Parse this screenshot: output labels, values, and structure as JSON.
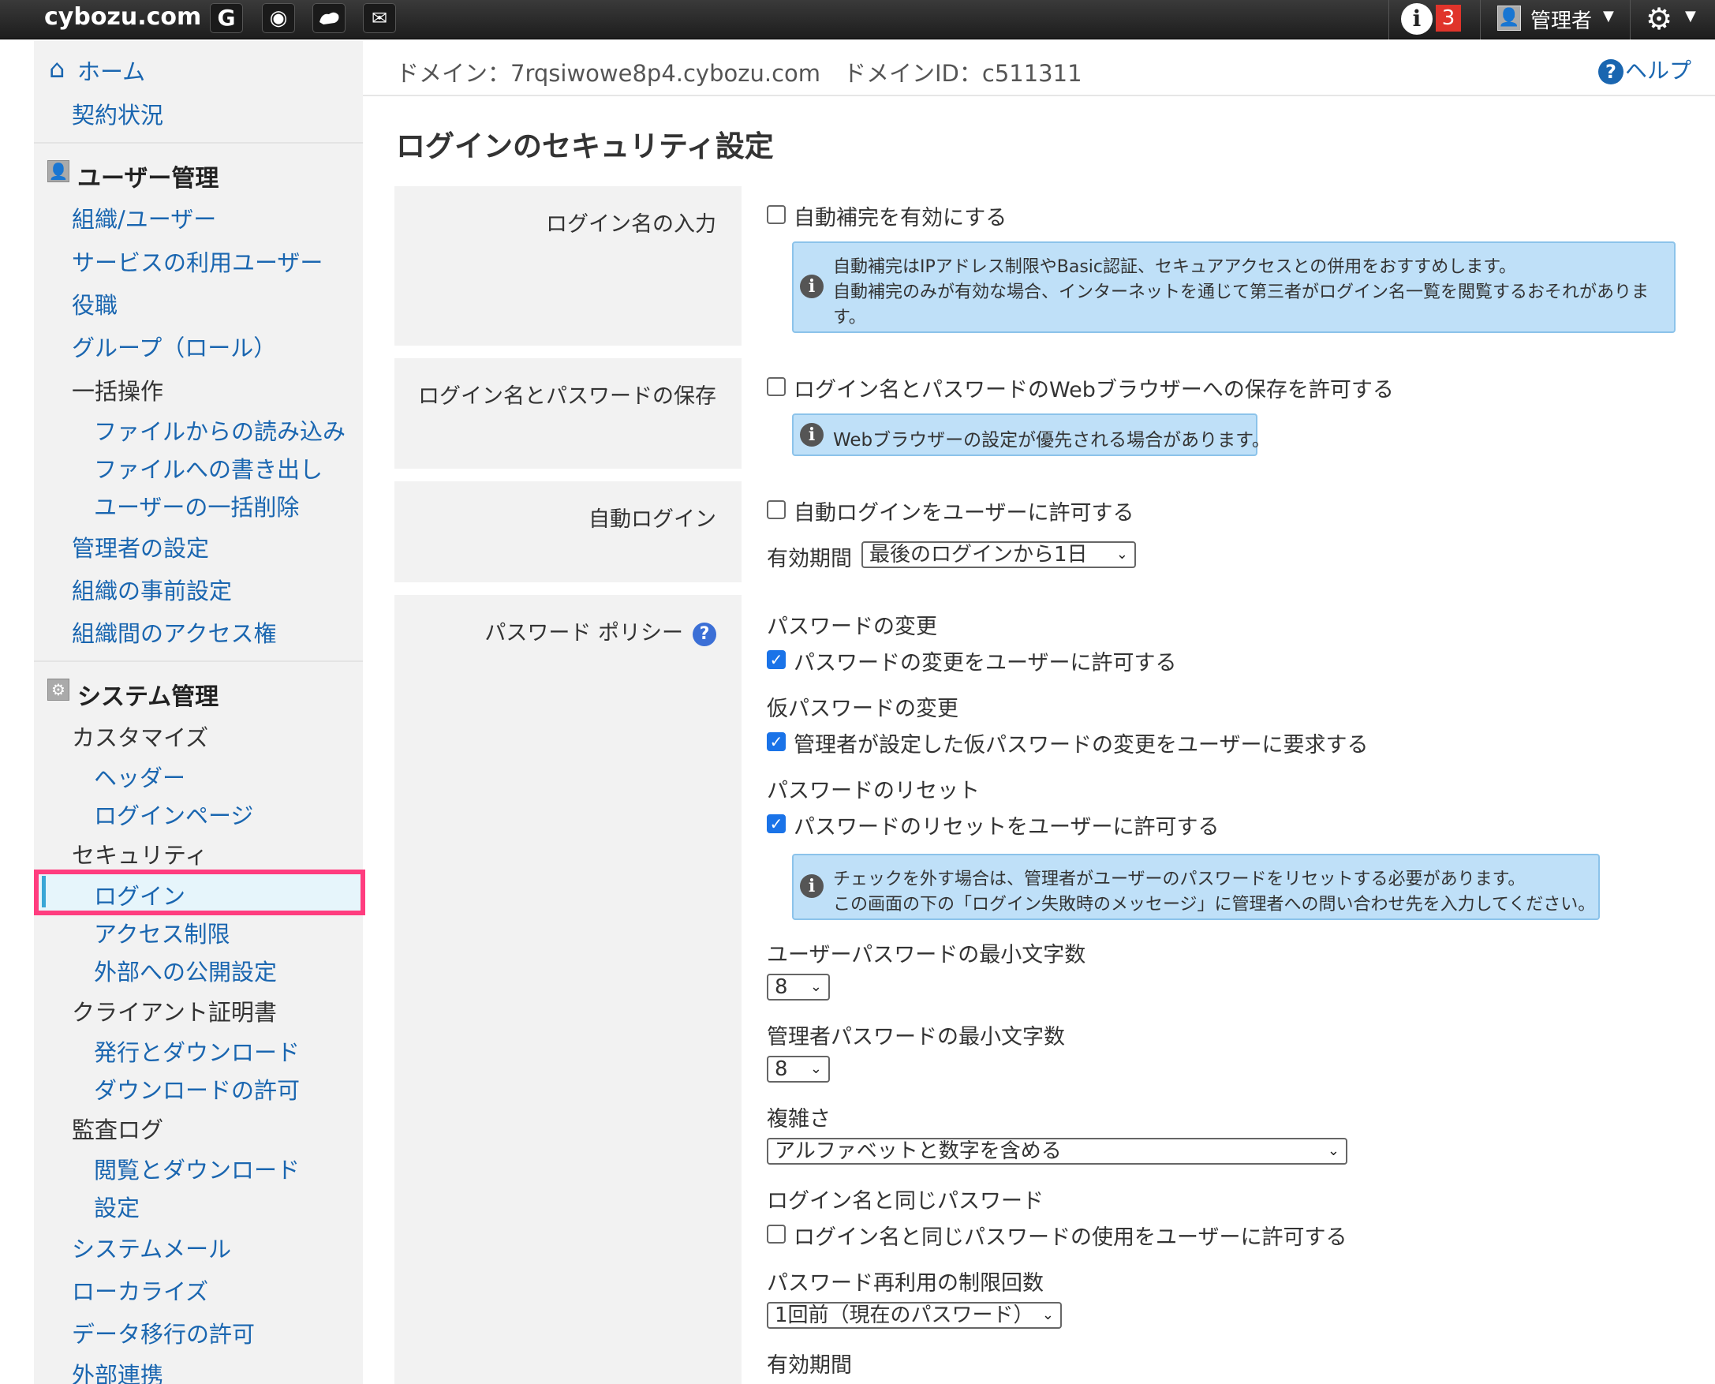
{
  "topbar": {
    "logo": "cybozu.com",
    "apps": [
      "G",
      "O",
      "",
      "✉"
    ],
    "info_badge": "3",
    "user_label": "管理者"
  },
  "sidebar": {
    "home": "ホーム",
    "contract": "契約状況",
    "user_mgmt": "ユーザー管理",
    "org_user": "組織/ユーザー",
    "service_user": "サービスの利用ユーザー",
    "role": "役職",
    "group": "グループ（ロール）",
    "bulk": "一括操作",
    "import": "ファイルからの読み込み",
    "export": "ファイルへの書き出し",
    "bulk_delete": "ユーザーの一括削除",
    "admin_settings": "管理者の設定",
    "org_pre": "組織の事前設定",
    "org_access": "組織間のアクセス権",
    "system_mgmt": "システム管理",
    "customize": "カスタマイズ",
    "header": "ヘッダー",
    "login_page": "ログインページ",
    "security": "セキュリティ",
    "login": "ログイン",
    "access_limit": "アクセス制限",
    "external_public": "外部への公開設定",
    "client_cert": "クライアント証明書",
    "issue_download": "発行とダウンロード",
    "download_allow": "ダウンロードの許可",
    "audit_log": "監査ログ",
    "view_download": "閲覧とダウンロード",
    "audit_settings": "設定",
    "system_mail": "システムメール",
    "localize": "ローカライズ",
    "data_migration": "データ移行の許可",
    "external_link": "外部連携"
  },
  "main": {
    "domain_line": "ドメイン：7rqsiwowe8p4.cybozu.com　ドメインID：c511311",
    "help": "ヘルプ",
    "title": "ログインのセキュリティ設定",
    "login_name_input": {
      "label": "ログイン名の入力",
      "checkbox": "自動補完を有効にする",
      "checked": false,
      "note1": "自動補完はIPアドレス制限やBasic認証、セキュアアクセスとの併用をおすすめします。",
      "note2": "自動補完のみが有効な場合、インターネットを通じて第三者がログイン名一覧を閲覧するおそれがありま",
      "note3": "す。"
    },
    "save_credentials": {
      "label": "ログイン名とパスワードの保存",
      "checkbox": "ログイン名とパスワードのWebブラウザーへの保存を許可する",
      "checked": false,
      "note": "Webブラウザーの設定が優先される場合があります。"
    },
    "auto_login": {
      "label": "自動ログイン",
      "checkbox": "自動ログインをユーザーに許可する",
      "checked": false,
      "period_label": "有効期間",
      "period_value": "最後のログインから1日"
    },
    "password_policy": {
      "label": "パスワード ポリシー",
      "change_heading": "パスワードの変更",
      "change_checkbox": "パスワードの変更をユーザーに許可する",
      "temp_heading": "仮パスワードの変更",
      "temp_checkbox": "管理者が設定した仮パスワードの変更をユーザーに要求する",
      "reset_heading": "パスワードのリセット",
      "reset_checkbox": "パスワードのリセットをユーザーに許可する",
      "reset_note1": "チェックを外す場合は、管理者がユーザーのパスワードをリセットする必要があります。",
      "reset_note2": "この画面の下の「ログイン失敗時のメッセージ」に管理者への問い合わせ先を入力してください。",
      "user_min_heading": "ユーザーパスワードの最小文字数",
      "user_min_value": "8",
      "admin_min_heading": "管理者パスワードの最小文字数",
      "admin_min_value": "8",
      "complexity_heading": "複雑さ",
      "complexity_value": "アルファベットと数字を含める",
      "same_heading": "ログイン名と同じパスワード",
      "same_checkbox": "ログイン名と同じパスワードの使用をユーザーに許可する",
      "reuse_heading": "パスワード再利用の制限回数",
      "reuse_value": "1回前（現在のパスワード）",
      "expiry_heading": "有効期間"
    }
  }
}
